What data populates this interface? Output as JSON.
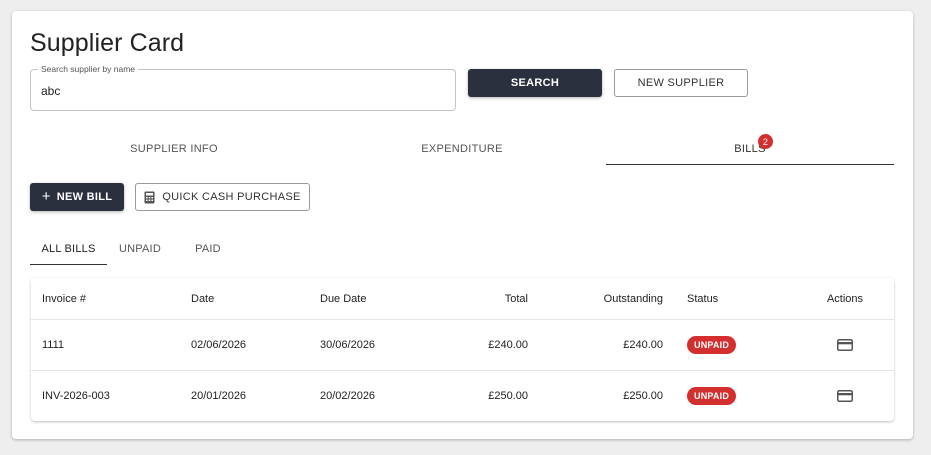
{
  "page": {
    "title": "Supplier Card"
  },
  "search": {
    "label": "Search supplier by name",
    "value": "abc",
    "button_label": "SEARCH"
  },
  "actions": {
    "new_supplier_label": "NEW SUPPLIER"
  },
  "tabs": [
    {
      "label": "SUPPLIER INFO",
      "active": false
    },
    {
      "label": "EXPENDITURE",
      "active": false
    },
    {
      "label": "BILLS",
      "active": true,
      "badge": "2"
    }
  ],
  "bills_toolbar": {
    "new_bill_label": "NEW BILL",
    "quick_cash_label": "QUICK CASH PURCHASE",
    "new_bill_icon": "plus-icon",
    "quick_cash_icon": "calculator-icon"
  },
  "bill_filters": [
    {
      "label": "ALL BILLS",
      "active": true
    },
    {
      "label": "UNPAID",
      "active": false
    },
    {
      "label": "PAID",
      "active": false
    }
  ],
  "table": {
    "headers": {
      "invoice": "Invoice #",
      "date": "Date",
      "due_date": "Due Date",
      "total": "Total",
      "outstanding": "Outstanding",
      "status": "Status",
      "actions": "Actions"
    },
    "rows": [
      {
        "invoice": "1111",
        "date": "02/06/2026",
        "due_date": "30/06/2026",
        "total": "£240.00",
        "outstanding": "£240.00",
        "status": "UNPAID",
        "action_icon": "credit-card-icon"
      },
      {
        "invoice": "INV-2026-003",
        "date": "20/01/2026",
        "due_date": "20/02/2026",
        "total": "£250.00",
        "outstanding": "£250.00",
        "status": "UNPAID",
        "action_icon": "credit-card-icon"
      }
    ]
  },
  "colors": {
    "primary_dark": "#2b303f",
    "badge_red": "#d32f2f",
    "status_unpaid": "#d32f2f"
  }
}
